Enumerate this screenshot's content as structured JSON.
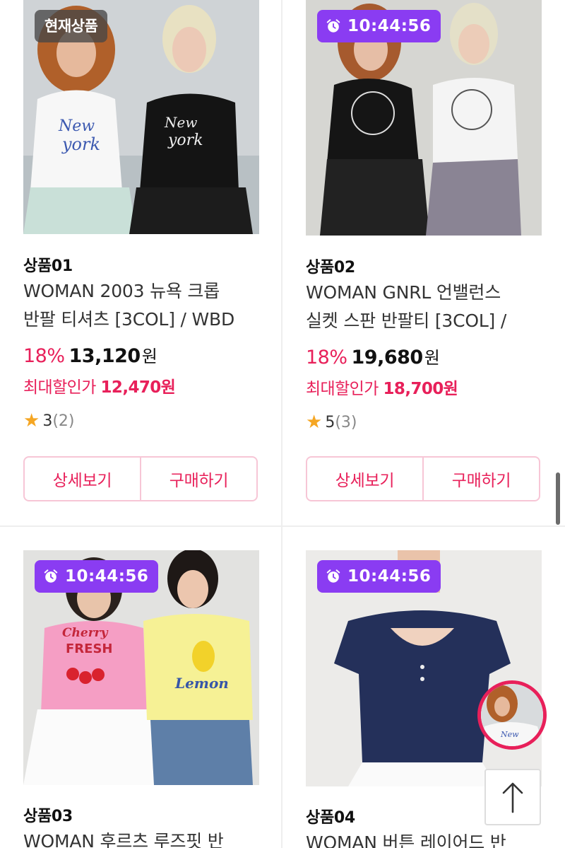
{
  "products": [
    {
      "badge": "현재상품",
      "name": "상품01",
      "title_line1": "WOMAN 2003 뉴욕 크롭",
      "title_line2": "반팔 티셔츠 [3COL] / WBD",
      "discount_rate": "18%",
      "price": "13,120",
      "currency": "원",
      "max_discount_label": "최대할인가",
      "max_discount_price": "12,470원",
      "rating": "3",
      "review_count": "(2)",
      "detail_label": "상세보기",
      "buy_label": "구매하기",
      "shirt_text_1": "New",
      "shirt_text_2": "york"
    },
    {
      "badge": "10:44:56",
      "name": "상품02",
      "title_line1": "WOMAN GNRL 언밸런스",
      "title_line2": "실켓 스판 반팔티 [3COL] /",
      "discount_rate": "18%",
      "price": "19,680",
      "currency": "원",
      "max_discount_label": "최대할인가",
      "max_discount_price": "18,700원",
      "rating": "5",
      "review_count": "(3)",
      "detail_label": "상세보기",
      "buy_label": "구매하기"
    },
    {
      "badge": "10:44:56",
      "name": "상품03",
      "title_partial": "WOMAN 후르츠 루즈핏 반",
      "shirt_text_1": "Cherry",
      "shirt_text_2": "FRESH",
      "shirt_text_3": "Lemon"
    },
    {
      "badge": "10:44:56",
      "name": "상품04",
      "title_partial": "WOMAN 버튼 레이어드 반"
    }
  ],
  "colors": {
    "accent": "#e8205a",
    "timer_badge": "#8a3cf2",
    "star": "#f5a623",
    "button_border": "#f7c6d6"
  },
  "icons": {
    "timer": "alarm-clock-icon",
    "rating": "star-icon",
    "scroll_top": "arrow-up-icon"
  }
}
